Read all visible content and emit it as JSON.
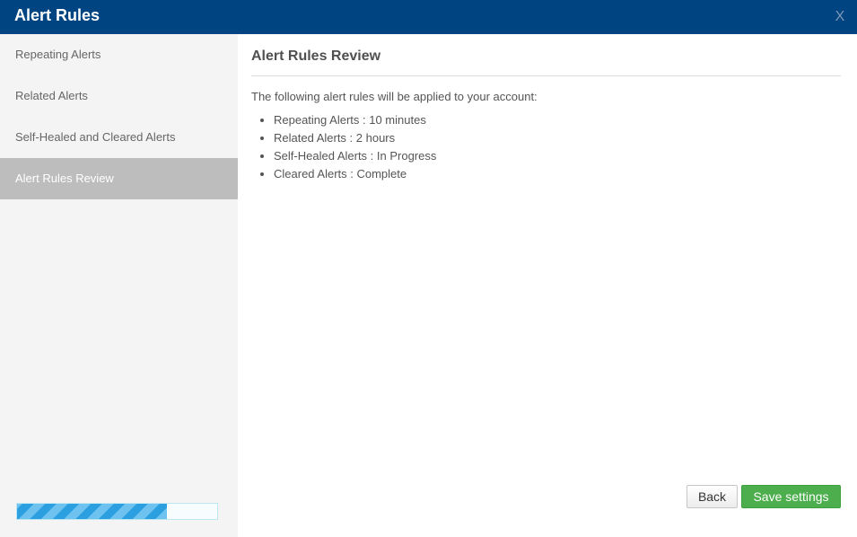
{
  "dialog": {
    "title": "Alert Rules",
    "close_label": "X"
  },
  "sidebar": {
    "items": [
      {
        "label": "Repeating Alerts",
        "active": false
      },
      {
        "label": "Related Alerts",
        "active": false
      },
      {
        "label": "Self-Healed and Cleared Alerts",
        "active": false
      },
      {
        "label": "Alert Rules Review",
        "active": true
      }
    ],
    "progress_percent": 75
  },
  "main": {
    "heading": "Alert Rules Review",
    "intro": "The following alert rules will be applied to your account:",
    "rules": [
      "Repeating Alerts : 10 minutes",
      "Related Alerts : 2 hours",
      "Self-Healed Alerts : In Progress",
      "Cleared Alerts : Complete"
    ]
  },
  "buttons": {
    "back_label": "Back",
    "save_label": "Save settings"
  },
  "colors": {
    "titlebar": "#004582",
    "active_nav": "#bdbdbd",
    "progress": "#2b9fe0",
    "save_button": "#4cae4c"
  }
}
